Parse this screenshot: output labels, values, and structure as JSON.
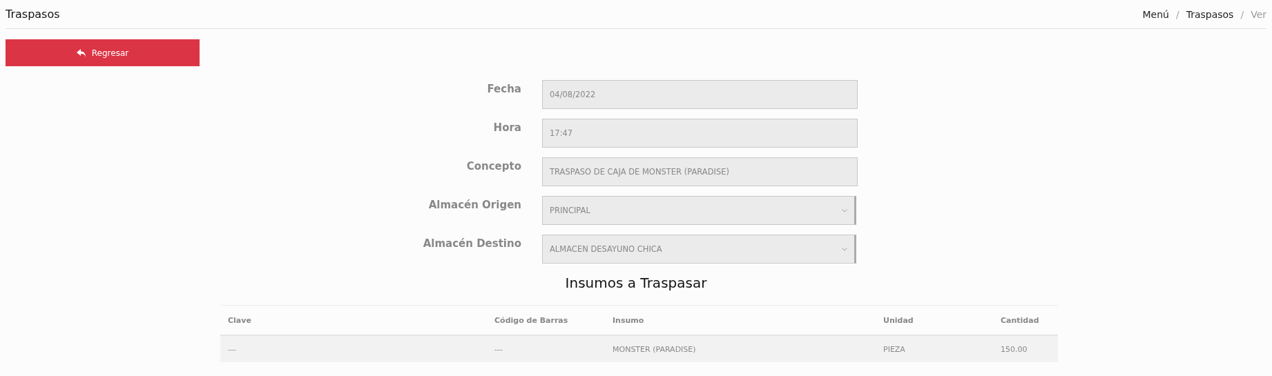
{
  "header": {
    "title": "Traspasos",
    "breadcrumb": [
      {
        "label": "Menú",
        "selected": false
      },
      {
        "label": "Traspasos",
        "selected": false
      },
      {
        "label": "Ver",
        "selected": true
      }
    ],
    "separator": "/"
  },
  "back_button": {
    "label": "Regresar"
  },
  "form": [
    {
      "label": "Fecha",
      "kind": "input",
      "value": "04/08/2022"
    },
    {
      "label": "Hora",
      "kind": "input",
      "value": "17:47"
    },
    {
      "label": "Concepto",
      "kind": "input",
      "value": "TRASPASO DE CAJA DE MONSTER (PARADISE)"
    },
    {
      "label": "Almacén Origen",
      "kind": "select",
      "value": "PRINCIPAL"
    },
    {
      "label": "Almacén Destino",
      "kind": "select",
      "value": "ALMACEN DESAYUNO CHICA"
    }
  ],
  "section_title": "Insumos a Traspasar",
  "table": {
    "columns": [
      "Clave",
      "Código de Barras",
      "Insumo",
      "Unidad",
      "Cantidad"
    ],
    "rows": [
      [
        "---",
        "---",
        "MONSTER (PARADISE)",
        "PIEZA",
        "150.00"
      ]
    ]
  }
}
